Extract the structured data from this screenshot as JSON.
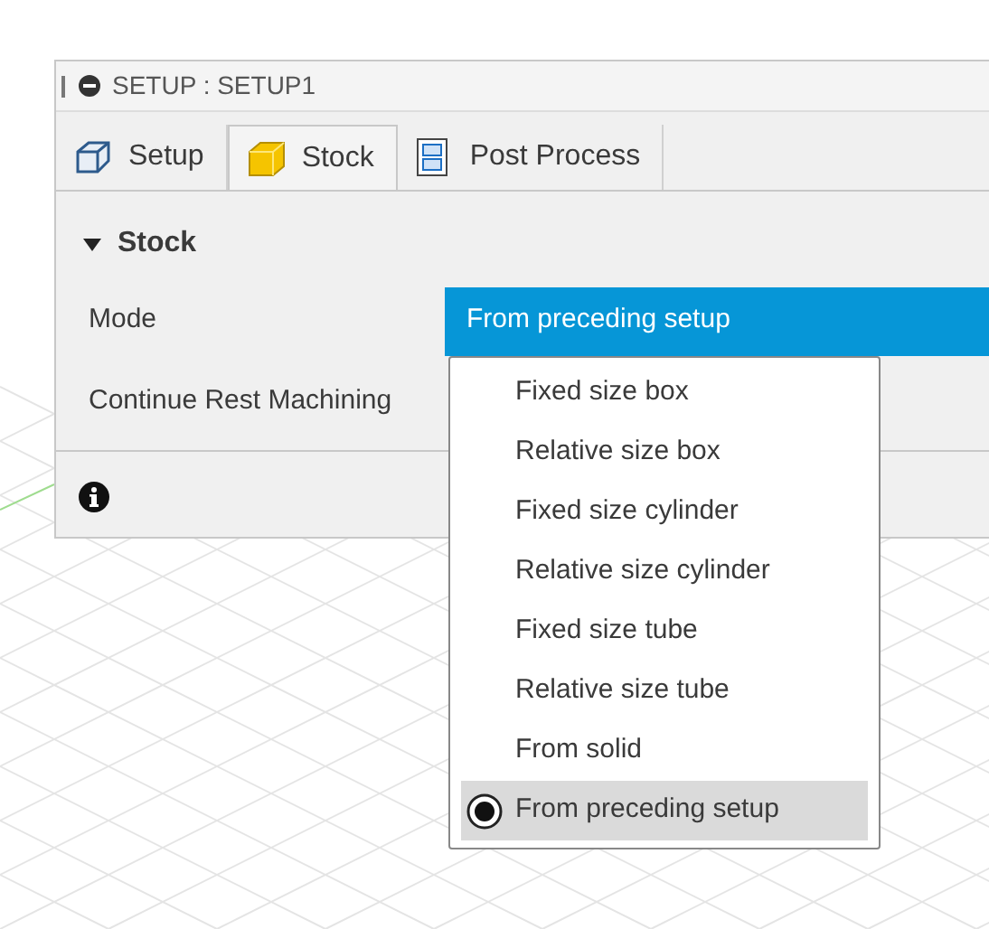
{
  "window": {
    "title": "SETUP : SETUP1"
  },
  "tabs": [
    {
      "label": "Setup",
      "kind": "setup",
      "selected": false
    },
    {
      "label": "Stock",
      "kind": "stock",
      "selected": true
    },
    {
      "label": "Post Process",
      "kind": "post",
      "selected": false
    }
  ],
  "section": {
    "title": "Stock",
    "expanded": true
  },
  "fields": [
    {
      "label": "Mode",
      "value": "From preceding setup"
    },
    {
      "label": "Continue Rest Machining"
    }
  ],
  "dropdown": {
    "options": [
      {
        "label": "Fixed size box",
        "selected": false
      },
      {
        "label": "Relative size box",
        "selected": false
      },
      {
        "label": "Fixed size cylinder",
        "selected": false
      },
      {
        "label": "Relative size cylinder",
        "selected": false
      },
      {
        "label": "Fixed size tube",
        "selected": false
      },
      {
        "label": "Relative size tube",
        "selected": false
      },
      {
        "label": "From solid",
        "selected": false
      },
      {
        "label": "From preceding setup",
        "selected": true
      }
    ]
  }
}
